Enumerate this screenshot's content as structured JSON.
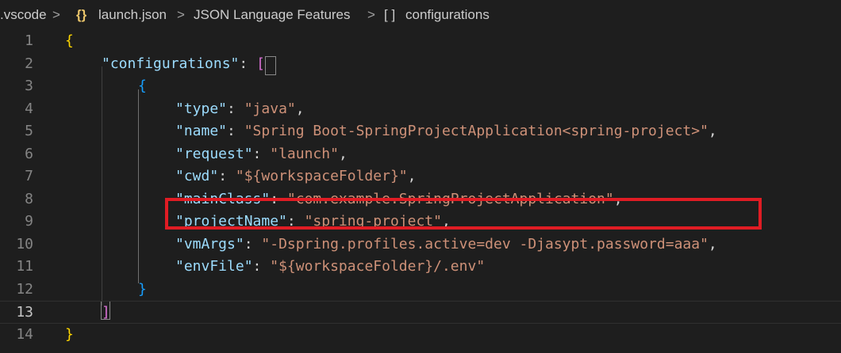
{
  "breadcrumb": {
    "folder": ".vscode",
    "file_icon": "{}",
    "file": "launch.json",
    "language": "JSON Language Features",
    "array_icon": "[ ]",
    "node": "configurations",
    "separator": ">"
  },
  "editor": {
    "current_line": 13,
    "line_numbers": [
      "1",
      "2",
      "3",
      "4",
      "5",
      "6",
      "7",
      "8",
      "9",
      "10",
      "11",
      "12",
      "13",
      "14"
    ],
    "lines": {
      "l1_open": "{",
      "l2_key": "\"configurations\"",
      "l2_colon": ": ",
      "l2_open": "[",
      "l3_open": "{",
      "l4_key": "\"type\"",
      "l4_val": "\"java\"",
      "l5_key": "\"name\"",
      "l5_val": "\"Spring Boot-SpringProjectApplication<spring-project>\"",
      "l6_key": "\"request\"",
      "l6_val": "\"launch\"",
      "l7_key": "\"cwd\"",
      "l7_val": "\"${workspaceFolder}\"",
      "l8_key": "\"mainClass\"",
      "l8_val": "\"com.example.SpringProjectApplication\"",
      "l9_key": "\"projectName\"",
      "l9_val": "\"spring-project\"",
      "l10_key": "\"vmArgs\"",
      "l10_val": "\"-Dspring.profiles.active=dev -Djasypt.password=aaa\"",
      "l11_key": "\"envFile\"",
      "l11_val": "\"${workspaceFolder}/.env\"",
      "l12_close": "}",
      "l13_close": "]",
      "l14_close": "}",
      "colon": ": ",
      "comma": ","
    }
  },
  "annotation": {
    "color": "#e01c24",
    "target_key": "vmArgs"
  }
}
